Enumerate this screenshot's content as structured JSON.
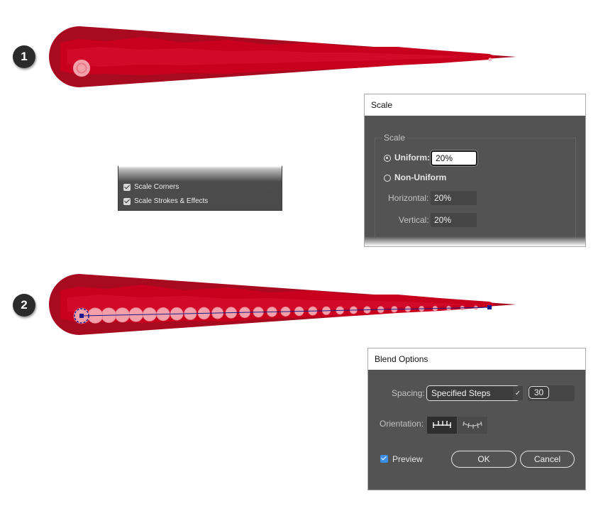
{
  "steps": [
    "1",
    "2"
  ],
  "scale_options": {
    "scale_corners": "Scale Corners",
    "scale_strokes": "Scale Strokes & Effects"
  },
  "scale_dialog": {
    "title": "Scale",
    "group_label": "Scale",
    "uniform_label": "Uniform:",
    "uniform_value": "20%",
    "non_uniform_label": "Non-Uniform",
    "horizontal_label": "Horizontal:",
    "horizontal_value": "20%",
    "vertical_label": "Vertical:",
    "vertical_value": "20%"
  },
  "blend_dialog": {
    "title": "Blend Options",
    "spacing_label": "Spacing:",
    "spacing_value": "Specified Steps",
    "steps_value": "30",
    "orientation_label": "Orientation:",
    "preview_label": "Preview",
    "ok_label": "OK",
    "cancel_label": "Cancel"
  },
  "colors": {
    "shape_dark": "#a80a1f",
    "shape_mid": "#c8001e",
    "dot_pink": "#f4a0ab",
    "anchor_blue": "#1a1a8c",
    "dialog_bg": "#535353",
    "preview_check": "#3a8ee6"
  },
  "icons": [
    "checkbox-checked-icon",
    "radio-selected-icon",
    "radio-unselected-icon",
    "chevron-down-icon",
    "align-to-page-icon",
    "align-to-path-icon",
    "preview-checkbox-icon"
  ]
}
